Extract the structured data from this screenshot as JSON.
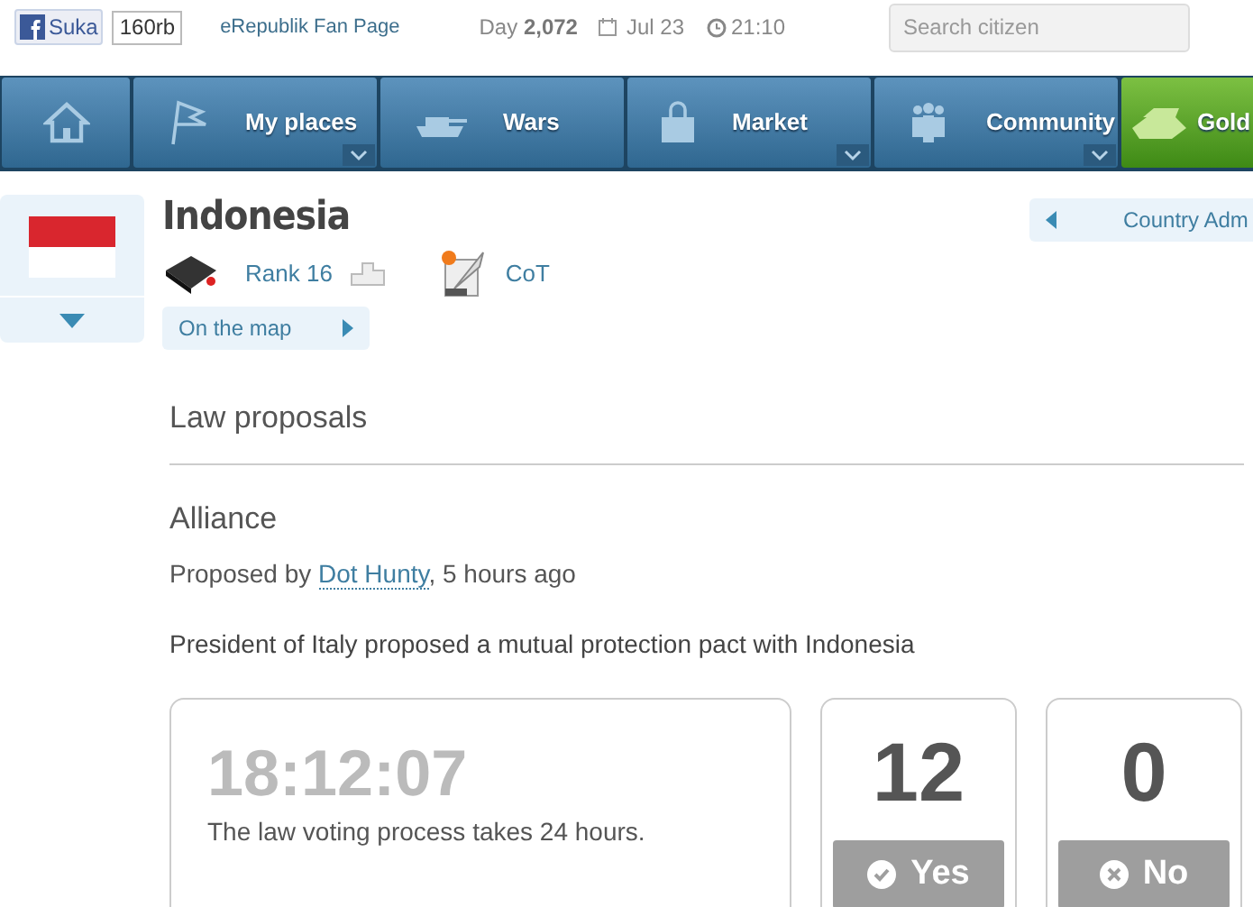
{
  "top_bar": {
    "like_button": "Suka",
    "like_count": "160rb",
    "fan_page_link": "eRepublik Fan Page",
    "day_label": "Day",
    "day_number": "2,072",
    "date": "Jul 23",
    "time": "21:10",
    "search": {
      "placeholder": "Search citizen"
    }
  },
  "nav": [
    {
      "kind": "home",
      "has_dropdown": false
    },
    {
      "kind": "regular",
      "label": "My places",
      "has_dropdown": true
    },
    {
      "kind": "regular",
      "label": "Wars",
      "has_dropdown": false
    },
    {
      "kind": "regular",
      "label": "Market",
      "has_dropdown": true
    },
    {
      "kind": "regular",
      "label": "Community",
      "has_dropdown": true
    },
    {
      "kind": "gold",
      "label": "Gold",
      "has_dropdown": false
    }
  ],
  "country": {
    "name": "Indonesia",
    "rank": "Rank 16",
    "cot": "CoT",
    "map_link": "On the map",
    "admin_link": "Country Adm"
  },
  "section_title": "Law proposals",
  "proposal": {
    "title": "Alliance",
    "proposed_prefix": "Proposed by",
    "proposer": "Dot Hunty",
    "proposed_suffix": ", 5 hours ago",
    "description": "President of Italy proposed a mutual protection pact with Indonesia",
    "countdown": "18:12:07",
    "countdown_note": "The law voting process takes 24 hours.",
    "votes": [
      {
        "kind": "yes",
        "count": "12",
        "label": "Yes",
        "disabled": true
      },
      {
        "kind": "no",
        "count": "0",
        "label": "No",
        "disabled": true
      }
    ]
  }
}
